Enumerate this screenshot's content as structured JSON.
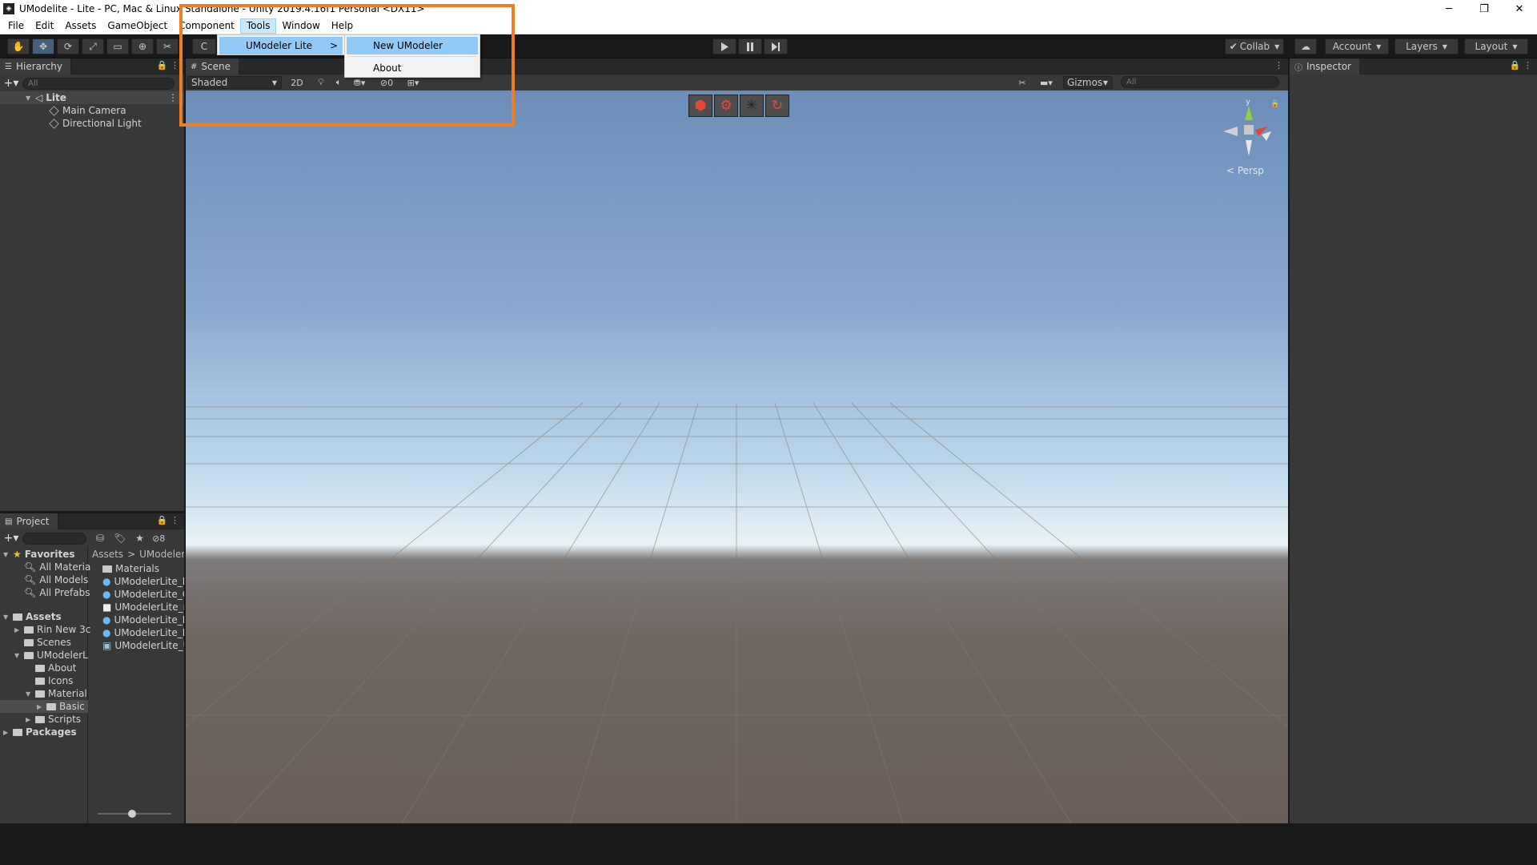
{
  "window": {
    "title": "UModelite - Lite - PC, Mac & Linux Standalone - Unity 2019.4.16f1 Personal <DX11>",
    "controls": [
      "─",
      "❐",
      "✕"
    ]
  },
  "menubar": {
    "items": [
      "File",
      "Edit",
      "Assets",
      "GameObject",
      "Component",
      "Tools",
      "Window",
      "Help"
    ],
    "active": "Tools"
  },
  "tools_menu": {
    "item": "UModeler Lite",
    "arrow": ">",
    "submenu": [
      "New UModeler",
      "About"
    ]
  },
  "toolbar": {
    "transform_tools": [
      "✋",
      "✥",
      "⟳",
      "⤢",
      "▭",
      "⊕",
      "✂"
    ],
    "collapsed_label": "C",
    "collab": "Collab",
    "account": "Account",
    "layers": "Layers",
    "layout": "Layout"
  },
  "hierarchy": {
    "title": "Hierarchy",
    "search_placeholder": "All",
    "scene": "Lite",
    "objects": [
      "Main Camera",
      "Directional Light"
    ]
  },
  "scene_view": {
    "tab": "Scene",
    "shading": "Shaded",
    "mode_2d": "2D",
    "fx_count": "0",
    "gizmos": "Gizmos",
    "search_placeholder": "All",
    "persp": "< Persp",
    "axis_y": "y",
    "colors": {
      "x_axis": "#e0443c",
      "y_axis": "#8fcf3a",
      "z_axis": "#3d7bd6",
      "accent": "#f07d22"
    }
  },
  "inspector": {
    "title": "Inspector"
  },
  "project": {
    "title": "Project",
    "hidden_count": "8",
    "favorites_label": "Favorites",
    "favorites": [
      "All Materia",
      "All Models",
      "All Prefabs"
    ],
    "assets_label": "Assets",
    "asset_folders": [
      "Rin New 3c",
      "Scenes",
      "UModelerL"
    ],
    "umodeler_children": [
      "About",
      "Icons",
      "Material"
    ],
    "material_children": [
      "Basic"
    ],
    "scripts": "Scripts",
    "packages": "Packages",
    "breadcrumb": [
      "Assets",
      ">",
      "UModelerL"
    ],
    "files": [
      "Materials",
      "UModelerLite_I",
      "UModelerLite_C",
      "UModelerLite_r",
      "UModelerLite_F",
      "UModelerLite_F",
      "UModelerLite_U"
    ]
  }
}
